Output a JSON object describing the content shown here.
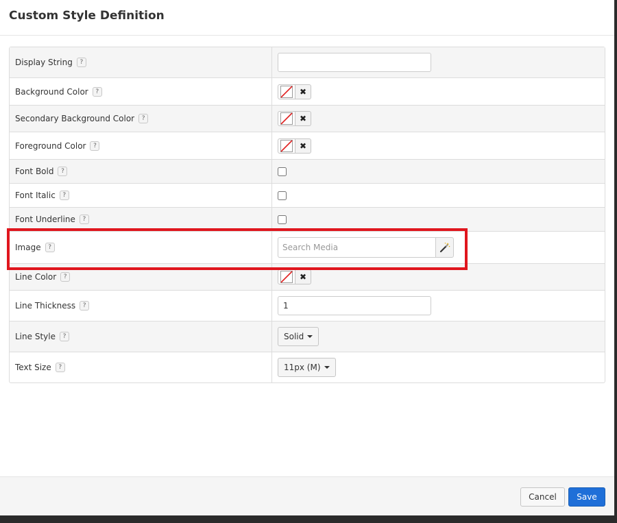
{
  "modal": {
    "title": "Custom Style Definition"
  },
  "help_glyph": "?",
  "rows": [
    {
      "label": "Display String",
      "type": "text",
      "value": ""
    },
    {
      "label": "Background Color",
      "type": "color"
    },
    {
      "label": "Secondary Background Color",
      "type": "color"
    },
    {
      "label": "Foreground Color",
      "type": "color"
    },
    {
      "label": "Font Bold",
      "type": "checkbox",
      "checked": false
    },
    {
      "label": "Font Italic",
      "type": "checkbox",
      "checked": false
    },
    {
      "label": "Font Underline",
      "type": "checkbox",
      "checked": false
    },
    {
      "label": "Image",
      "type": "media",
      "placeholder": "Search Media"
    },
    {
      "label": "Line Color",
      "type": "color"
    },
    {
      "label": "Line Thickness",
      "type": "text",
      "value": "1"
    },
    {
      "label": "Line Style",
      "type": "dropdown",
      "value": "Solid"
    },
    {
      "label": "Text Size",
      "type": "dropdown",
      "value": "11px (M)"
    }
  ],
  "clear_glyph": "✖",
  "footer": {
    "cancel_label": "Cancel",
    "save_label": "Save"
  },
  "colors": {
    "highlight": "#e0161e",
    "primary": "#1f6fd8",
    "swatch_slash": "#e02020"
  },
  "icons": {
    "help": "help-icon",
    "no-color": "no-color-icon",
    "clear": "close-icon",
    "wand": "magic-wand-icon",
    "caret": "caret-down-icon"
  }
}
